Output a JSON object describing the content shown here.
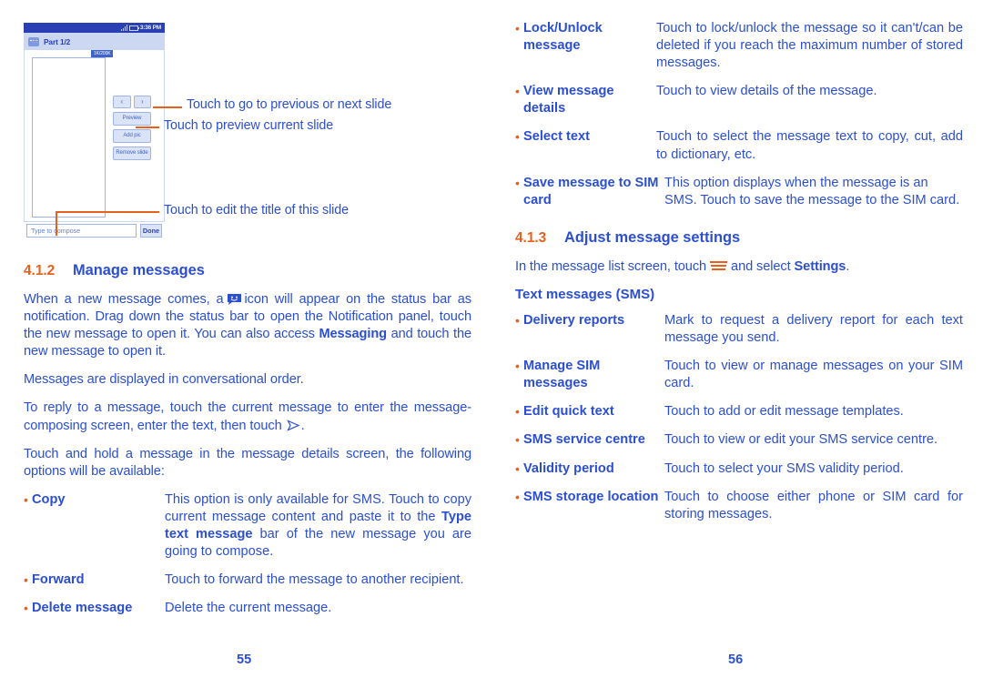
{
  "document": {
    "page_left_number": "55",
    "page_right_number": "56"
  },
  "phone_mockup": {
    "status_bar": {
      "time": "3:36 PM",
      "signal_icon": "signal-bars-icon",
      "battery_icon": "battery-icon"
    },
    "title_bar": {
      "app_icon": "message-icon",
      "title": "Part 1/2"
    },
    "slide": {
      "tag": "1K/200K"
    },
    "buttons": {
      "prev": "‹",
      "next": "›",
      "preview": "Preview",
      "add_pic": "Add pic",
      "remove_slide": "Remove slide"
    },
    "footer": {
      "compose_placeholder": "Type to compose",
      "done": "Done"
    }
  },
  "callouts": [
    {
      "text": "Touch to go to previous or next slide"
    },
    {
      "text": "Touch to preview current slide"
    },
    {
      "text": "Touch to edit the title of this slide"
    }
  ],
  "left_column": {
    "section": {
      "number": "4.1.2",
      "title": "Manage messages"
    },
    "paragraph_1": {
      "part_a": "When a new message comes, a",
      "icon": "smiley-message-icon",
      "part_b": "icon will appear on the status bar as notification. Drag down the status bar to open the Notification panel, touch the new message to open it. You can also access",
      "bold": "Messaging",
      "part_c": "and touch the new message to open it."
    },
    "paragraph_2": "Messages are displayed in conversational order.",
    "paragraph_3": {
      "part_a": "To reply to a message, touch the current message to enter the message-composing screen, enter the text, then touch",
      "icon": "send-arrow-icon",
      "part_b": "."
    },
    "paragraph_4": "Touch and hold a message in the message details screen, the following options will be available:",
    "options": [
      {
        "term": "Copy",
        "desc_a": "This option is only available for SMS. Touch to copy current message content and paste it to the",
        "desc_bold": "Type text message",
        "desc_b": "bar of the new message you are going to compose."
      },
      {
        "term": "Forward",
        "desc": "Touch to forward the message to another recipient."
      },
      {
        "term": "Delete message",
        "desc": "Delete the current message."
      }
    ]
  },
  "right_column": {
    "options_continued": [
      {
        "term": "Lock/Unlock message",
        "desc": "Touch to lock/unlock the message so it can't/can be deleted if you reach the maximum number of stored messages."
      },
      {
        "term": "View message details",
        "desc": "Touch to view details of the message."
      },
      {
        "term": "Select text",
        "desc": "Touch to select the message text to copy, cut, add to dictionary, etc."
      },
      {
        "term": "Save message to SIM card",
        "desc": "This option displays when the message is an SMS. Touch to save the message to the SIM card."
      }
    ],
    "section": {
      "number": "4.1.3",
      "title": "Adjust message settings"
    },
    "intro": {
      "part_a": "In the message list screen, touch",
      "icon": "menu-icon",
      "part_b": "and select",
      "bold": "Settings",
      "part_c": "."
    },
    "subheading": "Text messages (SMS)",
    "sms_settings": [
      {
        "term": "Delivery reports",
        "desc": "Mark to request a delivery report for each text message you send."
      },
      {
        "term": "Manage SIM messages",
        "desc": "Touch to view or manage messages on your SIM card."
      },
      {
        "term": "Edit quick text",
        "desc": "Touch to add or edit message templates."
      },
      {
        "term": "SMS service centre",
        "desc": "Touch to view or edit your SMS service centre."
      },
      {
        "term": "Validity period",
        "desc": "Touch to select your SMS validity period."
      },
      {
        "term": "SMS storage location",
        "desc": "Touch to choose either phone or SIM card for storing messages."
      }
    ]
  },
  "colors": {
    "accent_orange": "#e8601e",
    "text_blue": "#2b4fd0",
    "phone_header_blue": "#2b3fb5"
  }
}
